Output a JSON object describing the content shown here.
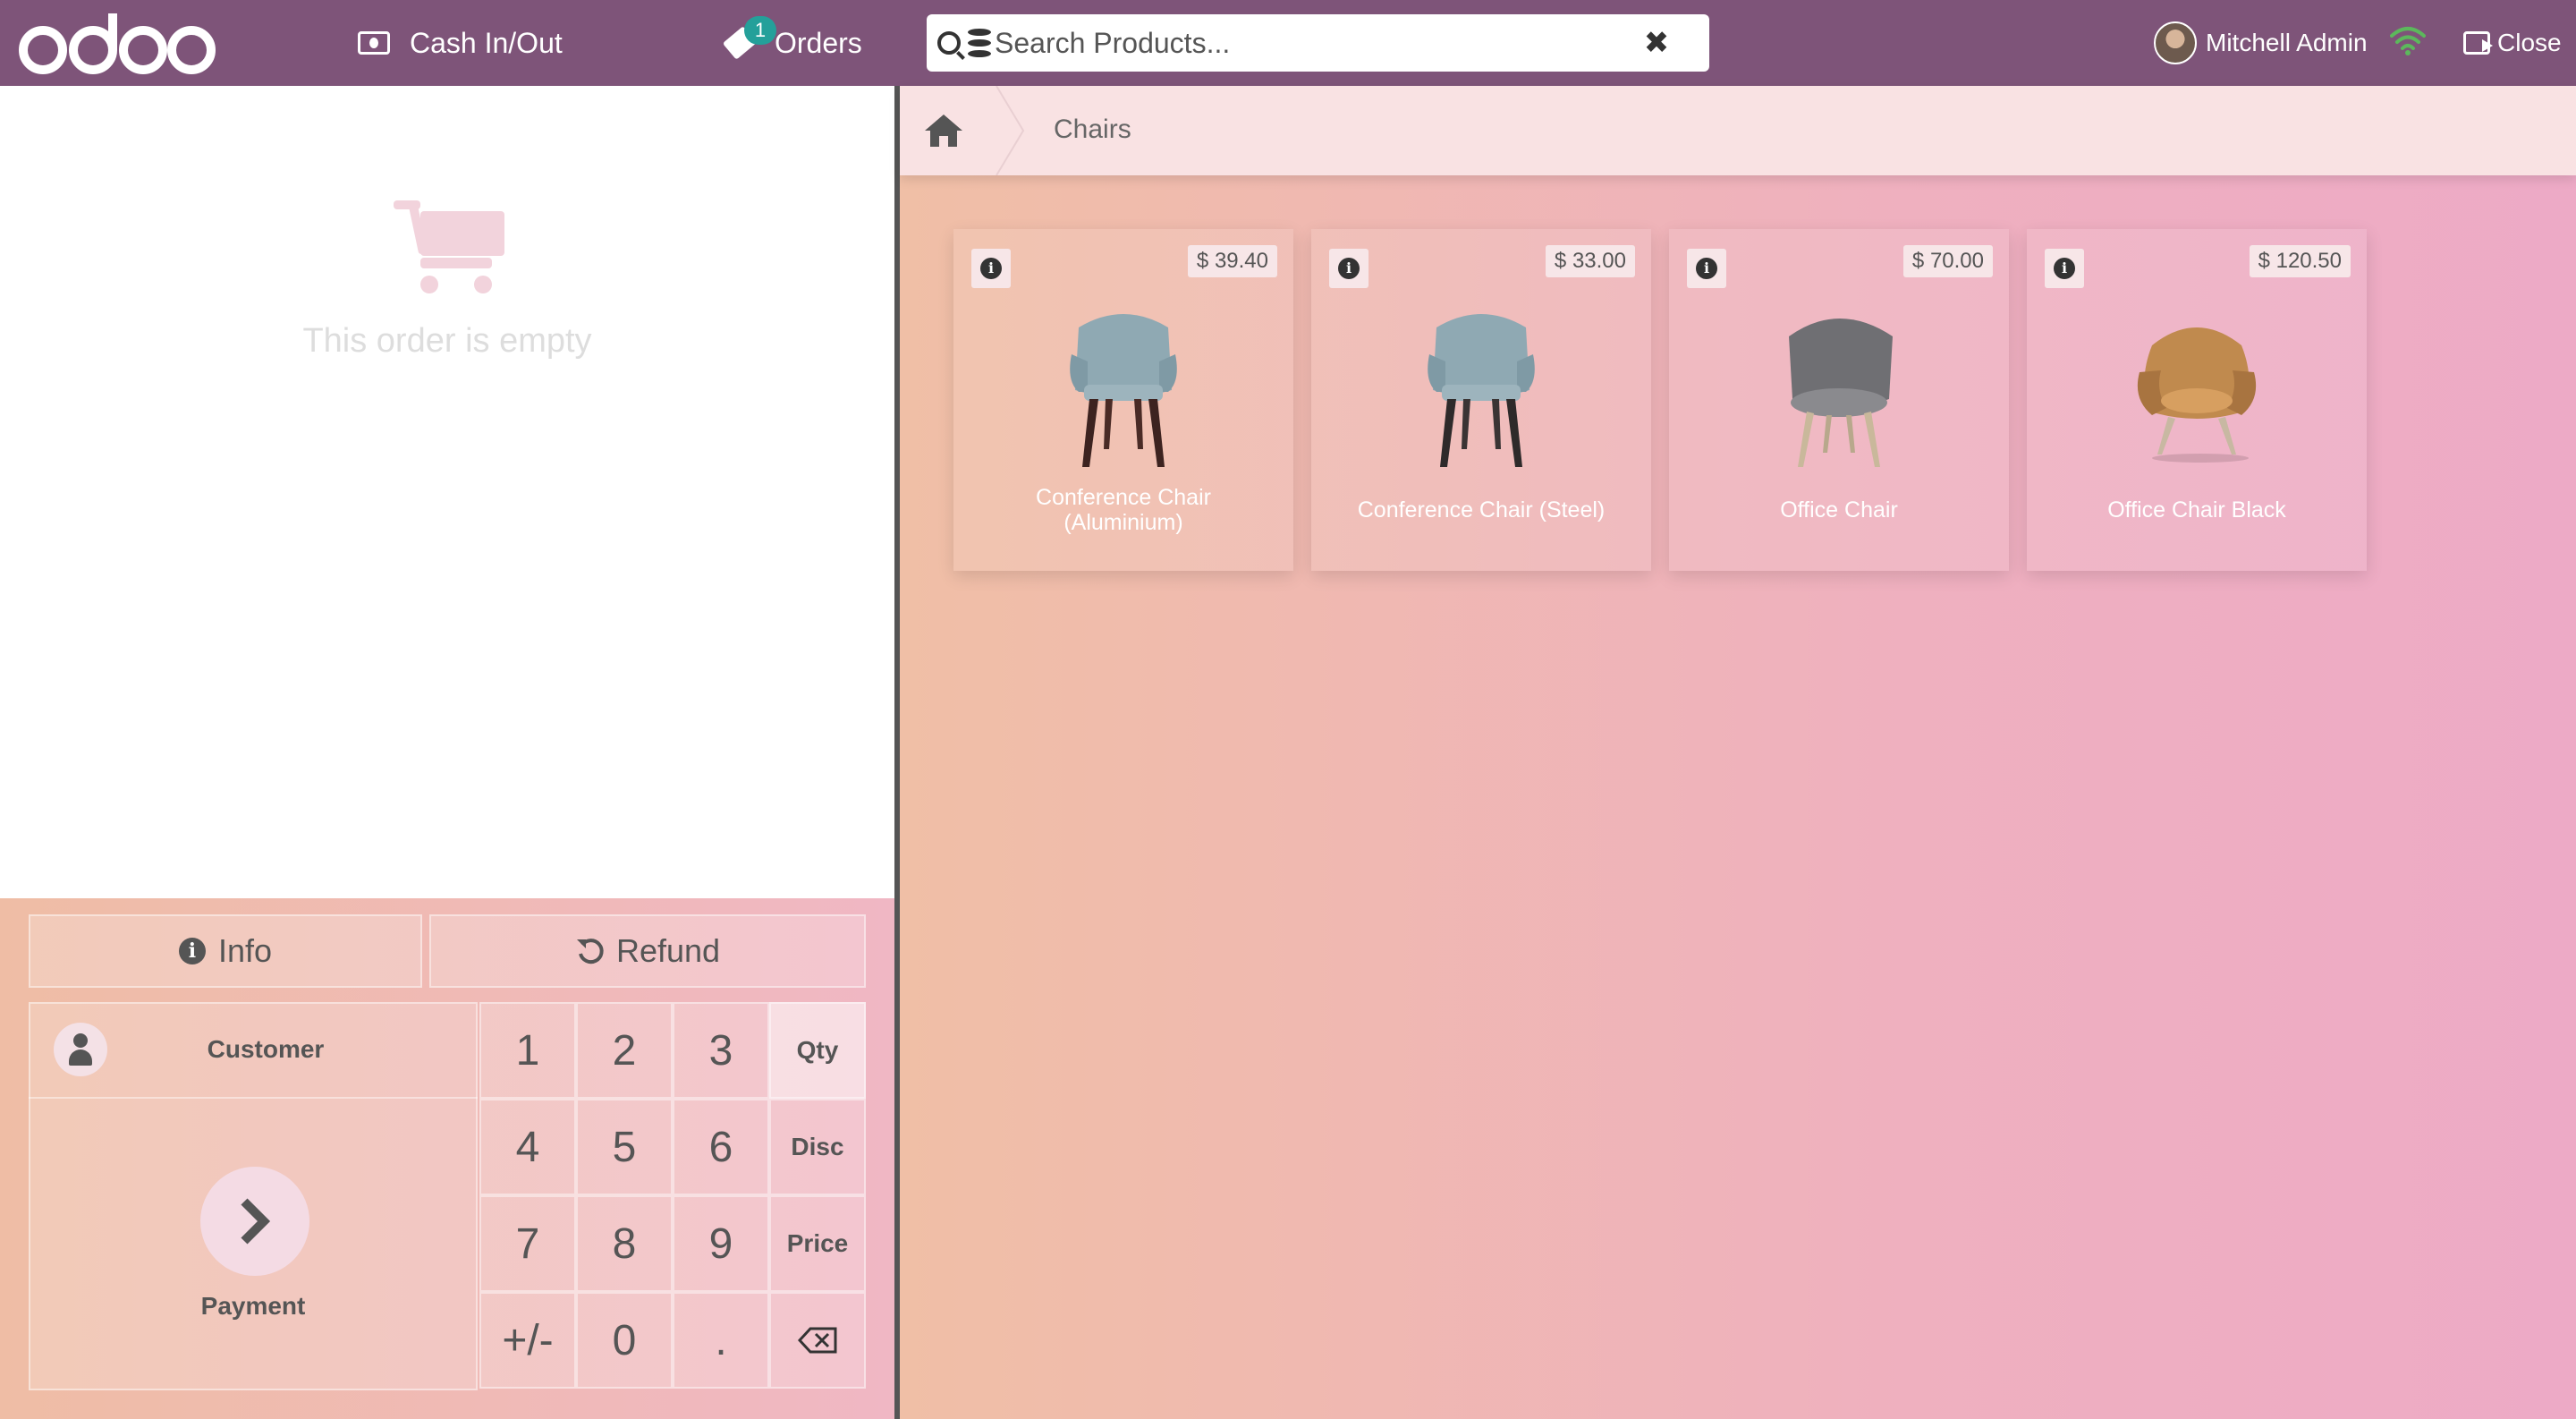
{
  "header": {
    "logo_text": "odoo",
    "cash_label": "Cash In/Out",
    "orders_label": "Orders",
    "orders_badge": "1",
    "search_placeholder": "Search Products...",
    "user_name": "Mitchell Admin",
    "close_label": "Close"
  },
  "order": {
    "empty_text": "This order is empty"
  },
  "controls": {
    "info_label": "Info",
    "refund_label": "Refund",
    "customer_label": "Customer",
    "payment_label": "Payment",
    "keys": {
      "k1": "1",
      "k2": "2",
      "k3": "3",
      "k4": "4",
      "k5": "5",
      "k6": "6",
      "k7": "7",
      "k8": "8",
      "k9": "9",
      "plusminus": "+/-",
      "k0": "0",
      "dot": ".",
      "qty": "Qty",
      "disc": "Disc",
      "price": "Price"
    },
    "selected_mode": "Qty"
  },
  "breadcrumb": {
    "category": "Chairs"
  },
  "products": [
    {
      "name_line1": "Conference Chair",
      "name_line2": "(Aluminium)",
      "price": "$ 39.40",
      "icon": "chair-blue-icon"
    },
    {
      "name": "Conference Chair (Steel)",
      "price": "$ 33.00",
      "icon": "chair-blue-icon"
    },
    {
      "name": "Office Chair",
      "price": "$ 70.00",
      "icon": "chair-grey-icon"
    },
    {
      "name": "Office Chair Black",
      "price": "$ 120.50",
      "icon": "chair-tan-icon"
    }
  ],
  "colors": {
    "topbar": "#7e5479",
    "badge": "#24a09a",
    "wifi": "#5cb85c"
  }
}
